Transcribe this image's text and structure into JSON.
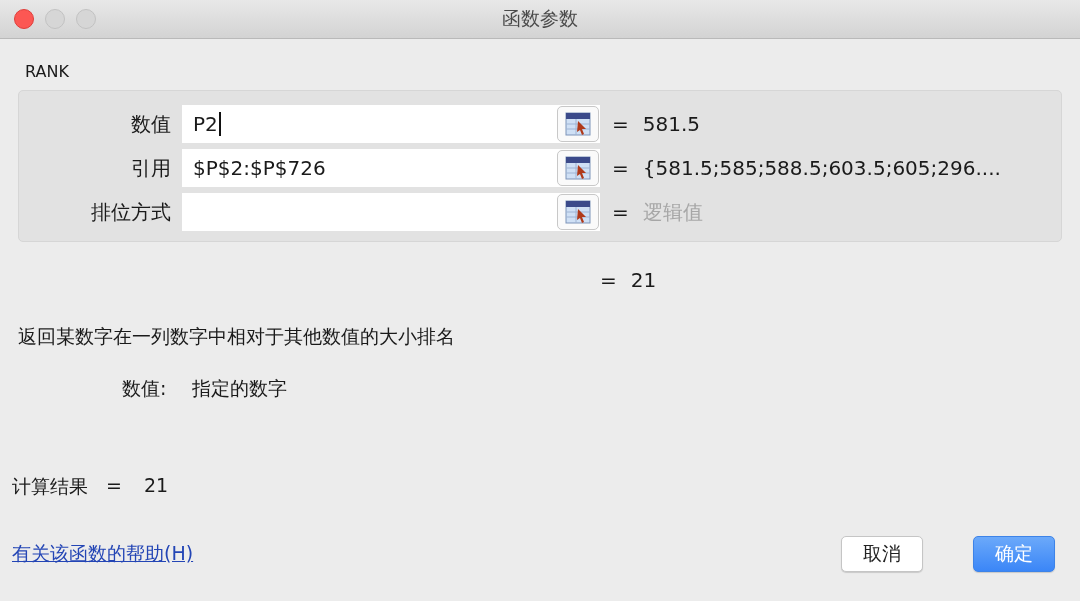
{
  "window": {
    "title": "函数参数"
  },
  "function_name": "RANK",
  "arguments": [
    {
      "label": "数值",
      "value": "P2",
      "focused": true,
      "equals": "=",
      "result": "581.5",
      "result_muted": false
    },
    {
      "label": "引用",
      "value": "$P$2:$P$726",
      "focused": false,
      "equals": "=",
      "result": "{581.5;585;588.5;603.5;605;296....",
      "result_muted": false
    },
    {
      "label": "排位方式",
      "focused": false,
      "equals": "=",
      "result": "逻辑值",
      "result_muted": true
    }
  ],
  "formula_result": {
    "equals": "=",
    "value": "21"
  },
  "description": "返回某数字在一列数字中相对于其他数值的大小排名",
  "argument_help": {
    "name": "数值:",
    "text": "指定的数字"
  },
  "calc_result": {
    "label": "计算结果",
    "equals": "=",
    "value": "21"
  },
  "help_link": "有关该函数的帮助(H)",
  "buttons": [
    {
      "label": "取消",
      "default": false
    },
    {
      "label": "确定",
      "default": true
    }
  ]
}
